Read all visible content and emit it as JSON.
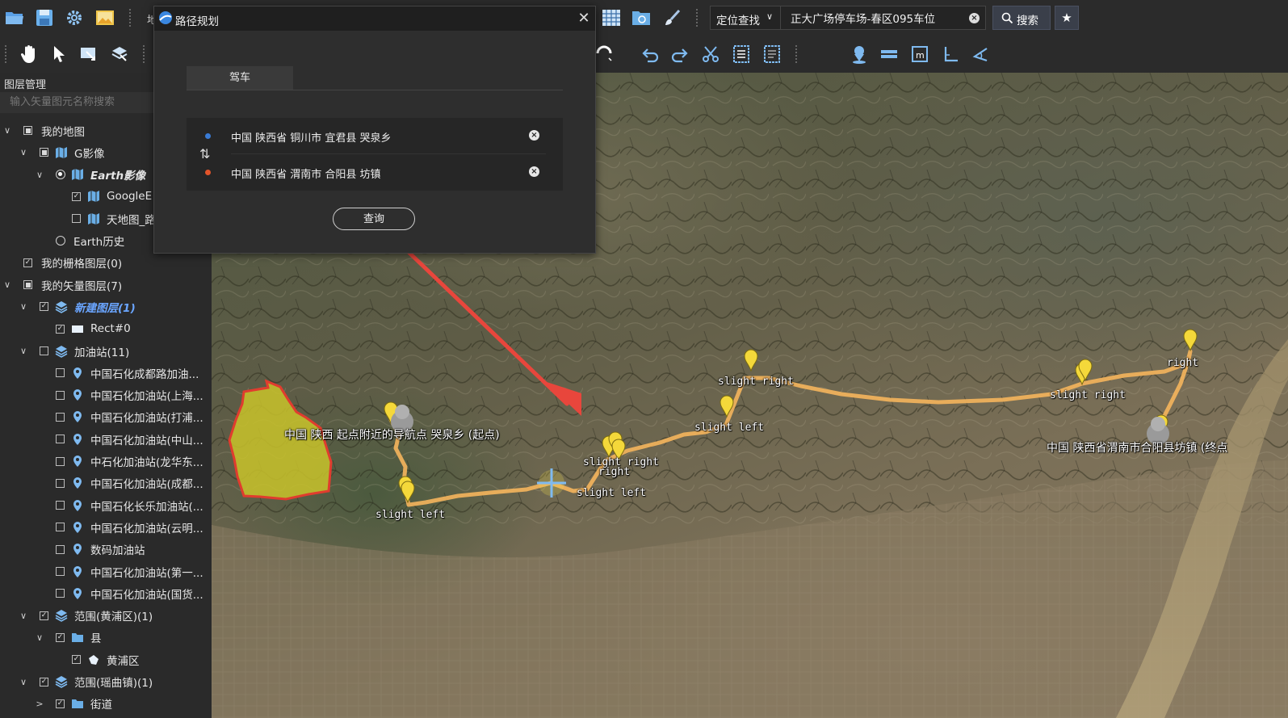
{
  "toolbar_top": {
    "search_mode": "定位查找",
    "search_value": "正大广场停车场-春区095车位",
    "search_button": "搜索",
    "partial_text": "地"
  },
  "toolbar_second": {
    "measure_label": "测量"
  },
  "layer_panel": {
    "title": "图层管理",
    "search_placeholder": "输入矢量图元名称搜索",
    "tree": [
      {
        "label": "我的地图"
      },
      {
        "label": "G影像"
      },
      {
        "label": "Earth影像"
      },
      {
        "label": "GoogleE"
      },
      {
        "label": "天地图_路"
      },
      {
        "label": "Earth历史"
      },
      {
        "label": "我的栅格图层(0)"
      },
      {
        "label": "我的矢量图层(7)"
      },
      {
        "label": "新建图层(1)"
      },
      {
        "label": "Rect#0"
      },
      {
        "label": "加油站(11)"
      },
      {
        "label": "中国石化成都路加油..."
      },
      {
        "label": "中国石化加油站(上海..."
      },
      {
        "label": "中国石化加油站(打浦..."
      },
      {
        "label": "中国石化加油站(中山..."
      },
      {
        "label": "中石化加油站(龙华东..."
      },
      {
        "label": "中国石化加油站(成都..."
      },
      {
        "label": "中国石化长乐加油站(..."
      },
      {
        "label": "中国石化加油站(云明..."
      },
      {
        "label": "数码加油站"
      },
      {
        "label": "中国石化加油站(第一..."
      },
      {
        "label": "中国石化加油站(国货..."
      },
      {
        "label": "范围(黄浦区)(1)"
      },
      {
        "label": "县"
      },
      {
        "label": "黄浦区"
      },
      {
        "label": "范围(瑶曲镇)(1)"
      },
      {
        "label": "街道"
      }
    ]
  },
  "dialog": {
    "title": "路径规划",
    "tab": "驾车",
    "start": "中国 陕西省 铜川市 宜君县 哭泉乡",
    "end": "中国 陕西省 渭南市 合阳县 坊镇",
    "query_button": "查询"
  },
  "map": {
    "labels": {
      "start": "中国 陕西 起点附近的导航点 哭泉乡 (起点)",
      "end": "中国 陕西省渭南市合阳县坊镇 (终点",
      "slight_left_1": "slight left",
      "slight_right_1": "slight right",
      "right_1": "right",
      "slight_left_2": "slight left",
      "slight_right_2": "slight right",
      "slight_left_3": "slight left",
      "slight_right_3": "slight right",
      "right_2": "right"
    },
    "colors": {
      "route": "#f2b35c",
      "polygon_fill": "#c9c32a",
      "polygon_stroke": "#e03c2e",
      "arrow": "#e8463c",
      "marker": "#f4d83a"
    }
  },
  "colors": {
    "panel_bg": "#2a2a2a",
    "toolbar_bg": "#2b2b2b",
    "start_dot": "#3a7bd5",
    "end_dot": "#e2542a",
    "accent_selected_layer": "#6aa5ff"
  }
}
